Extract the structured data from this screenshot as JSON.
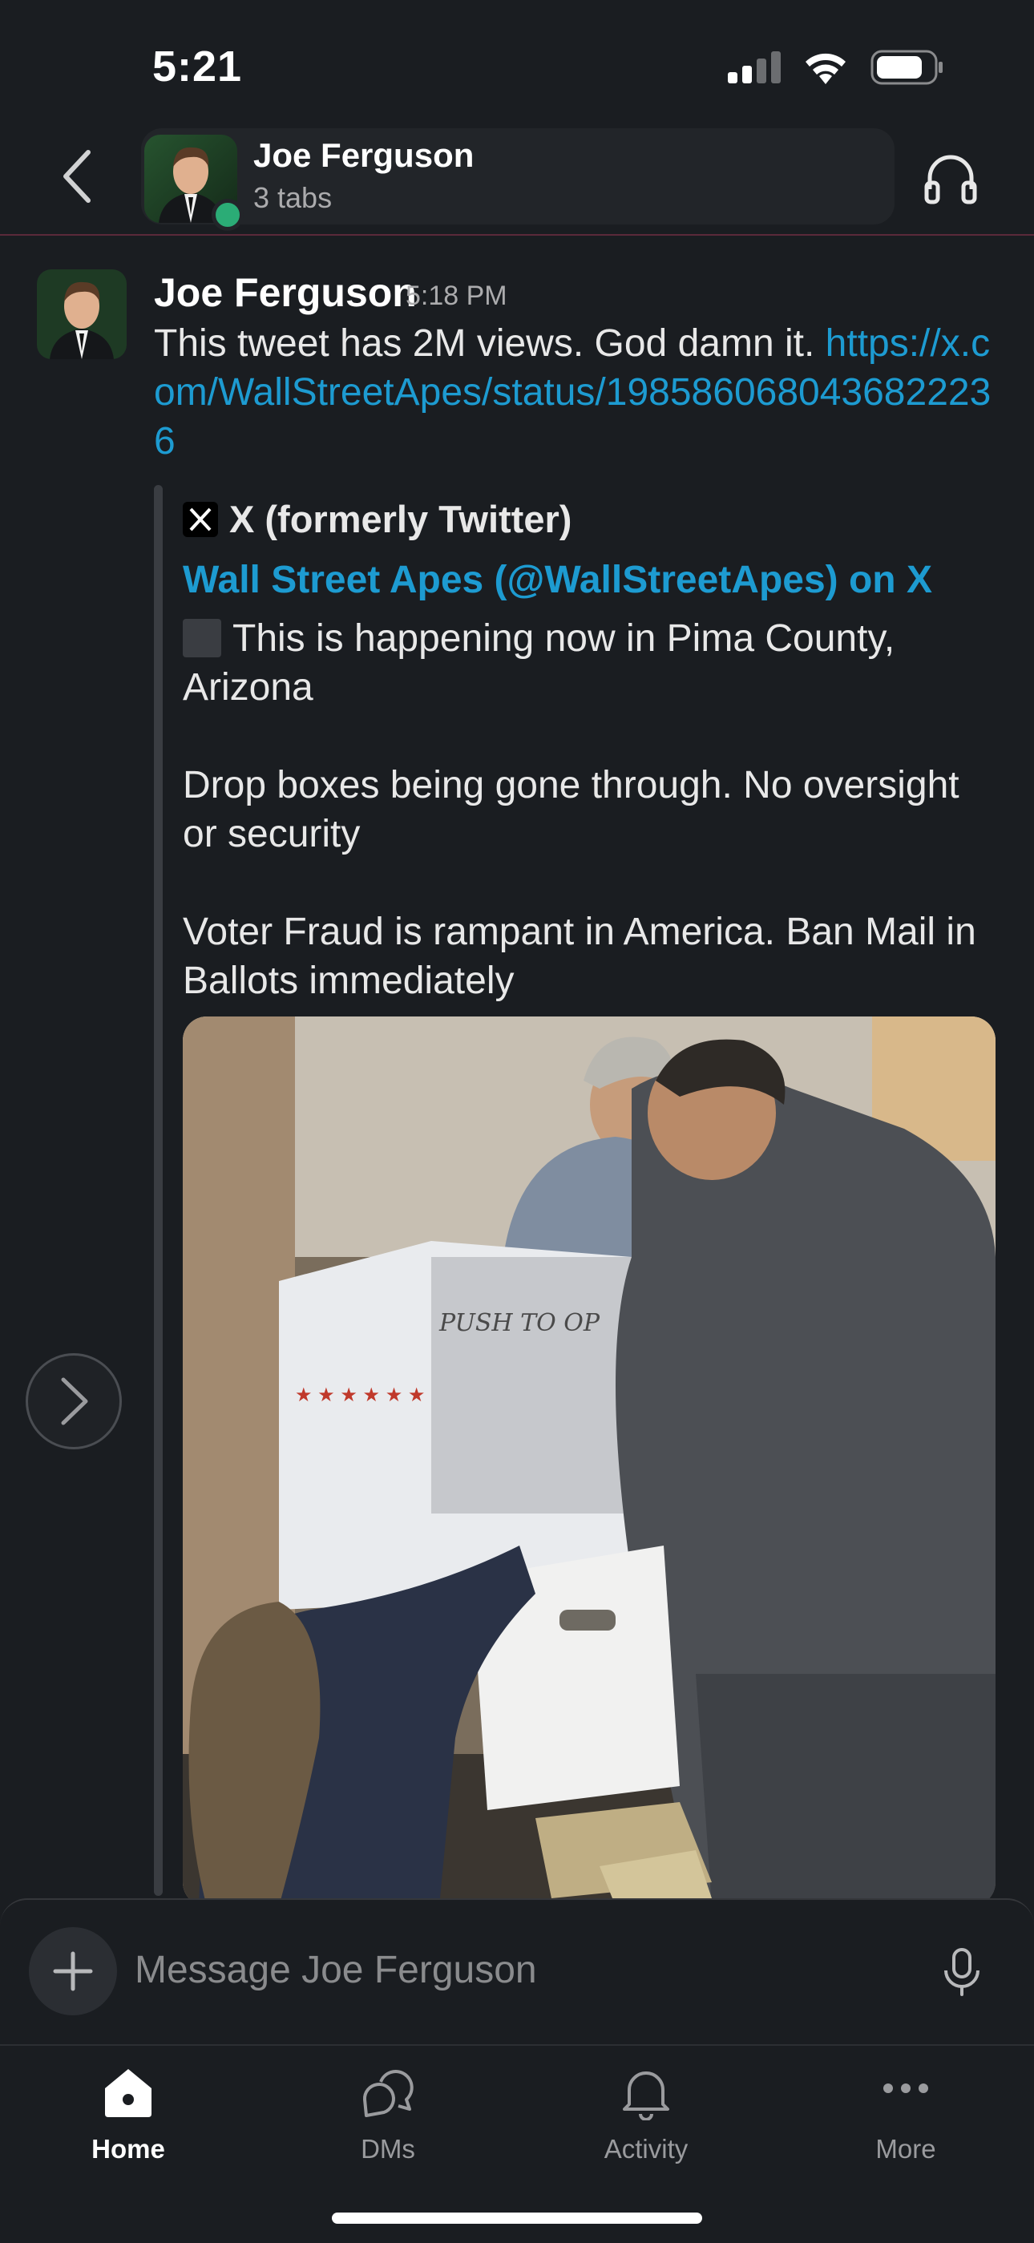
{
  "status_bar": {
    "time": "5:21"
  },
  "header": {
    "name": "Joe Ferguson",
    "subtitle": "3 tabs"
  },
  "message": {
    "author": "Joe Ferguson",
    "time": "5:18 PM",
    "text": "This tweet has 2M views. God damn it. ",
    "link": "https://x.com/WallStreetApes/status/1985860680436822236"
  },
  "unfurl": {
    "source": "X (formerly Twitter)",
    "title": "Wall Street Apes (@WallStreetApes) on X",
    "body": "This is happening now in Pima County, Arizona\n\nDrop boxes being gone through. No oversight or security\n\nVoter Fraud is rampant in America. Ban Mail in Ballots immediately",
    "image_print": "PUSH TO OP"
  },
  "composer": {
    "placeholder": "Message Joe Ferguson"
  },
  "tabs": [
    {
      "label": "Home",
      "icon": "home-icon",
      "active": true
    },
    {
      "label": "DMs",
      "icon": "dms-icon",
      "active": false
    },
    {
      "label": "Activity",
      "icon": "bell-icon",
      "active": false
    },
    {
      "label": "More",
      "icon": "more-icon",
      "active": false
    }
  ],
  "colors": {
    "background": "#1a1d21",
    "link": "#1d9bd1",
    "presence": "#2bac76"
  }
}
